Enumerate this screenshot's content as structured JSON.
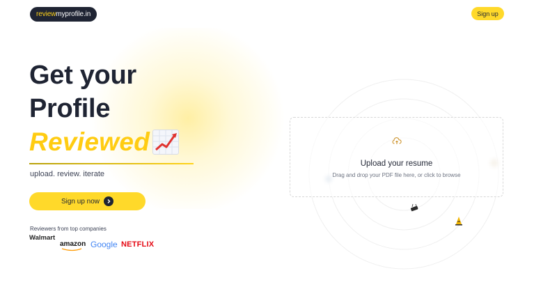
{
  "header": {
    "logo_part1": "review",
    "logo_part2": "myprofile.in",
    "signup_label": "Sign up"
  },
  "hero": {
    "line1": "Get your",
    "line2": "Profile",
    "accent": "Reviewed",
    "tagline": "upload. review. iterate",
    "cta_label": "Sign up now"
  },
  "reviewers": {
    "label": "Reviewers from top companies",
    "companies": [
      "Walmart",
      "amazon",
      "Google",
      "NETFLIX"
    ]
  },
  "upload": {
    "title": "Upload your resume",
    "subtitle": "Drag and drop your PDF file here, or click to browse"
  },
  "colors": {
    "accent_yellow": "#ffd92a",
    "dark": "#1f2433",
    "netflix_red": "#e50914"
  },
  "icons": [
    "upload-cloud-icon",
    "arrow-right-icon",
    "chart-increasing-icon",
    "binder-clip-icon",
    "traffic-cone-icon"
  ]
}
